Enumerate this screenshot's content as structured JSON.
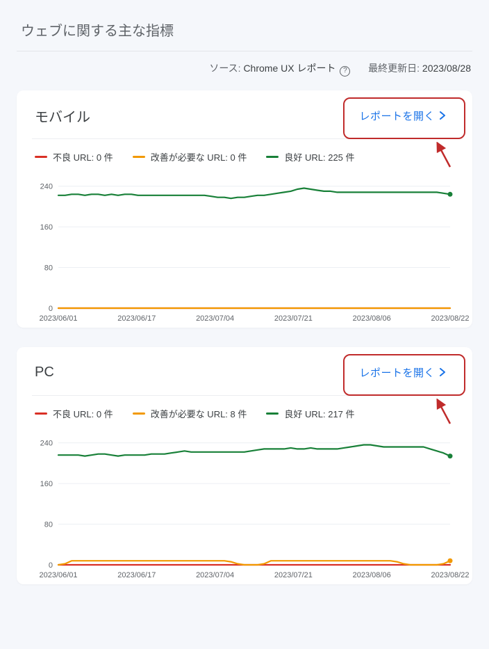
{
  "header": {
    "title": "ウェブに関する主な指標",
    "source_label": "ソース:",
    "source_value": "Chrome UX レポート",
    "last_updated_label": "最終更新日:",
    "last_updated_value": "2023/08/28"
  },
  "colors": {
    "bad": "#d93025",
    "need": "#f29900",
    "good": "#188038",
    "link": "#1a73e8",
    "highlight": "#c02b2b"
  },
  "open_report_label": "レポートを開く",
  "cards": [
    {
      "id": "mobile",
      "title": "モバイル",
      "legend": {
        "bad": "不良 URL: 0 件",
        "need": "改善が必要な URL: 0 件",
        "good": "良好 URL: 225 件"
      }
    },
    {
      "id": "pc",
      "title": "PC",
      "legend": {
        "bad": "不良 URL: 0 件",
        "need": "改善が必要な URL: 8 件",
        "good": "良好 URL: 217 件"
      }
    }
  ],
  "chart_data": [
    {
      "id": "mobile",
      "type": "line",
      "ylim": [
        0,
        260
      ],
      "yticks": [
        0,
        80,
        160,
        240
      ],
      "categories": [
        "2023/06/01",
        "2023/06/17",
        "2023/07/04",
        "2023/07/21",
        "2023/08/06",
        "2023/08/22"
      ],
      "xlabel": "",
      "ylabel": "",
      "series": [
        {
          "name": "bad",
          "color": "#d93025",
          "values": [
            0,
            0,
            0,
            0,
            0,
            0,
            0,
            0,
            0,
            0,
            0,
            0,
            0,
            0,
            0,
            0,
            0,
            0,
            0,
            0,
            0,
            0,
            0,
            0,
            0,
            0,
            0,
            0,
            0,
            0,
            0,
            0,
            0,
            0,
            0,
            0,
            0,
            0,
            0,
            0,
            0,
            0,
            0,
            0,
            0,
            0,
            0,
            0,
            0,
            0,
            0,
            0,
            0,
            0,
            0,
            0,
            0,
            0,
            0,
            0
          ]
        },
        {
          "name": "need",
          "color": "#f29900",
          "values": [
            0,
            0,
            0,
            0,
            0,
            0,
            0,
            0,
            0,
            0,
            0,
            0,
            0,
            0,
            0,
            0,
            0,
            0,
            0,
            0,
            0,
            0,
            0,
            0,
            0,
            0,
            0,
            0,
            0,
            0,
            0,
            0,
            0,
            0,
            0,
            0,
            0,
            0,
            0,
            0,
            0,
            0,
            0,
            0,
            0,
            0,
            0,
            0,
            0,
            0,
            0,
            0,
            0,
            0,
            0,
            0,
            0,
            0,
            0,
            0
          ]
        },
        {
          "name": "good",
          "color": "#188038",
          "values": [
            222,
            222,
            224,
            224,
            222,
            224,
            224,
            222,
            224,
            222,
            224,
            224,
            222,
            222,
            222,
            222,
            222,
            222,
            222,
            222,
            222,
            222,
            222,
            220,
            218,
            218,
            216,
            218,
            218,
            220,
            222,
            222,
            224,
            226,
            228,
            230,
            234,
            236,
            234,
            232,
            230,
            230,
            228,
            228,
            228,
            228,
            228,
            228,
            228,
            228,
            228,
            228,
            228,
            228,
            228,
            228,
            228,
            228,
            226,
            224
          ]
        }
      ]
    },
    {
      "id": "pc",
      "type": "line",
      "ylim": [
        0,
        260
      ],
      "yticks": [
        0,
        80,
        160,
        240
      ],
      "categories": [
        "2023/06/01",
        "2023/06/17",
        "2023/07/04",
        "2023/07/21",
        "2023/08/06",
        "2023/08/22"
      ],
      "xlabel": "",
      "ylabel": "",
      "series": [
        {
          "name": "bad",
          "color": "#d93025",
          "values": [
            0,
            0,
            0,
            0,
            0,
            0,
            0,
            0,
            0,
            0,
            0,
            0,
            0,
            0,
            0,
            0,
            0,
            0,
            0,
            0,
            0,
            0,
            0,
            0,
            0,
            0,
            0,
            0,
            0,
            0,
            0,
            0,
            0,
            0,
            0,
            0,
            0,
            0,
            0,
            0,
            0,
            0,
            0,
            0,
            0,
            0,
            0,
            0,
            0,
            0,
            0,
            0,
            0,
            0,
            0,
            0,
            0,
            0,
            0,
            0
          ]
        },
        {
          "name": "need",
          "color": "#f29900",
          "values": [
            0,
            2,
            8,
            8,
            8,
            8,
            8,
            8,
            8,
            8,
            8,
            8,
            8,
            8,
            8,
            8,
            8,
            8,
            8,
            8,
            8,
            8,
            8,
            8,
            8,
            8,
            6,
            2,
            0,
            0,
            0,
            2,
            8,
            8,
            8,
            8,
            8,
            8,
            8,
            8,
            8,
            8,
            8,
            8,
            8,
            8,
            8,
            8,
            8,
            8,
            8,
            6,
            2,
            0,
            0,
            0,
            0,
            0,
            2,
            8
          ]
        },
        {
          "name": "good",
          "color": "#188038",
          "values": [
            216,
            216,
            216,
            216,
            214,
            216,
            218,
            218,
            216,
            214,
            216,
            216,
            216,
            216,
            218,
            218,
            218,
            220,
            222,
            224,
            222,
            222,
            222,
            222,
            222,
            222,
            222,
            222,
            222,
            224,
            226,
            228,
            228,
            228,
            228,
            230,
            228,
            228,
            230,
            228,
            228,
            228,
            228,
            230,
            232,
            234,
            236,
            236,
            234,
            232,
            232,
            232,
            232,
            232,
            232,
            232,
            228,
            224,
            220,
            214
          ]
        }
      ]
    }
  ]
}
